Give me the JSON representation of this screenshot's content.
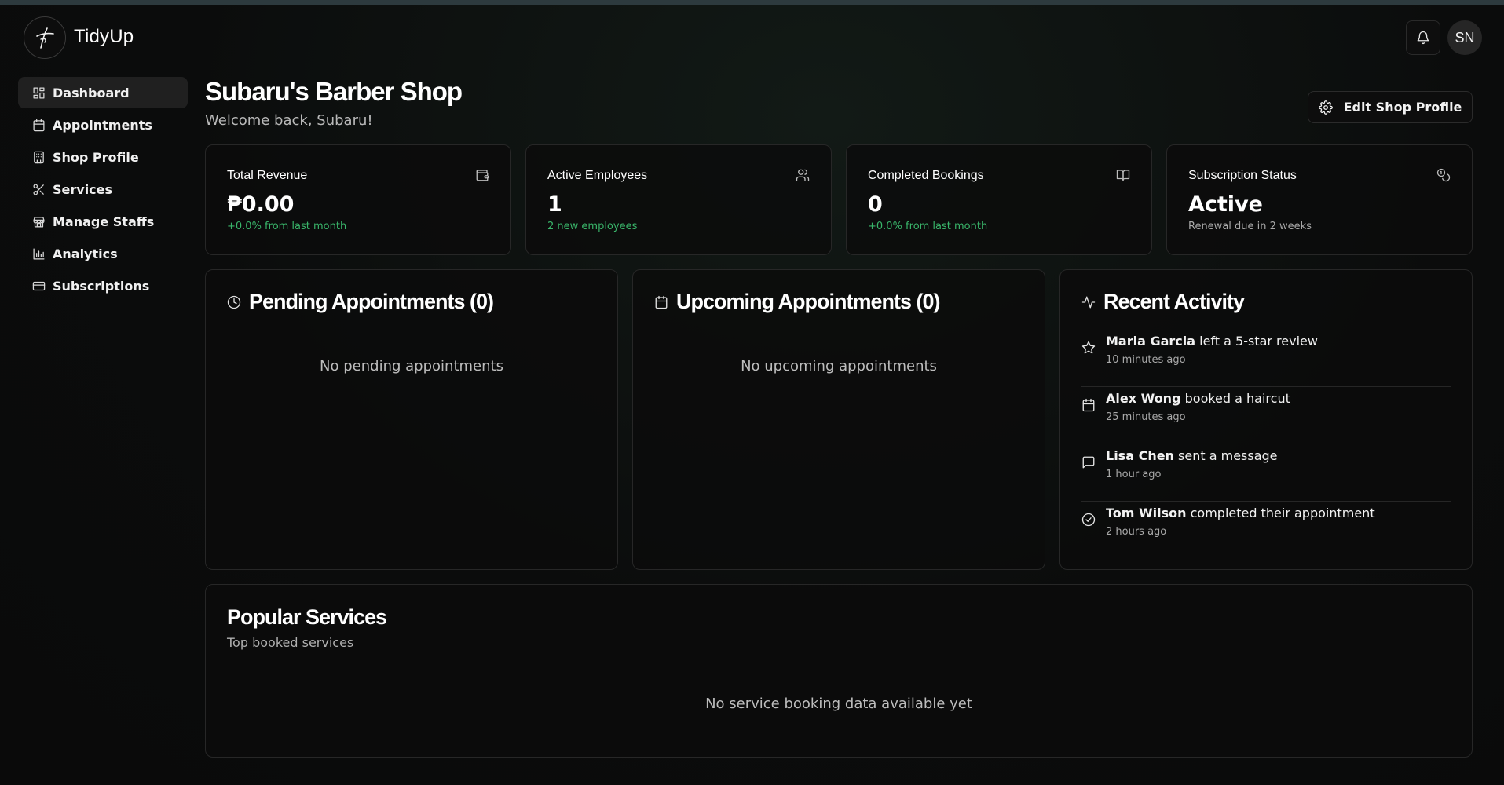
{
  "app": {
    "name": "TidyUp"
  },
  "header": {
    "avatar_initials": "SN"
  },
  "sidebar": {
    "items": [
      {
        "label": "Dashboard",
        "icon": "dashboard-icon",
        "active": true
      },
      {
        "label": "Appointments",
        "icon": "calendar-icon"
      },
      {
        "label": "Shop Profile",
        "icon": "shop-icon"
      },
      {
        "label": "Services",
        "icon": "scissors-icon"
      },
      {
        "label": "Manage Staffs",
        "icon": "store-icon"
      },
      {
        "label": "Analytics",
        "icon": "chart-icon"
      },
      {
        "label": "Subscriptions",
        "icon": "card-icon"
      }
    ]
  },
  "page": {
    "title": "Subaru's Barber Shop",
    "subtitle": "Welcome back, Subaru!",
    "edit_button": "Edit Shop Profile"
  },
  "stats": [
    {
      "label": "Total Revenue",
      "value": "₱0.00",
      "note": "+0.0% from last month",
      "note_color": "#39b56a",
      "icon": "wallet-icon"
    },
    {
      "label": "Active Employees",
      "value": "1",
      "note": "2 new employees",
      "note_color": "#39b56a",
      "icon": "users-icon"
    },
    {
      "label": "Completed Bookings",
      "value": "0",
      "note": "+0.0% from last month",
      "note_color": "#39b56a",
      "icon": "book-open-icon"
    },
    {
      "label": "Subscription Status",
      "value": "Active",
      "note": "Renewal due in 2 weeks",
      "note_color": "#a9a9a9",
      "icon": "coins-icon"
    }
  ],
  "pending": {
    "title": "Pending Appointments (0)",
    "empty": "No pending appointments"
  },
  "upcoming": {
    "title": "Upcoming Appointments (0)",
    "empty": "No upcoming appointments"
  },
  "recent": {
    "title": "Recent Activity",
    "items": [
      {
        "name": "Maria Garcia",
        "action": " left a 5-star review",
        "time": "10 minutes ago",
        "icon": "star-icon"
      },
      {
        "name": "Alex Wong",
        "action": " booked a haircut",
        "time": "25 minutes ago",
        "icon": "calendar-icon"
      },
      {
        "name": "Lisa Chen",
        "action": " sent a message",
        "time": "1 hour ago",
        "icon": "message-icon"
      },
      {
        "name": "Tom Wilson",
        "action": " completed their appointment",
        "time": "2 hours ago",
        "icon": "check-circle-icon"
      }
    ]
  },
  "popular": {
    "title": "Popular Services",
    "subtitle": "Top booked services",
    "empty": "No service booking data available yet"
  },
  "colors": {
    "accent_green": "#39b56a",
    "background": "#0b0c0c",
    "card_border": "#272727"
  }
}
